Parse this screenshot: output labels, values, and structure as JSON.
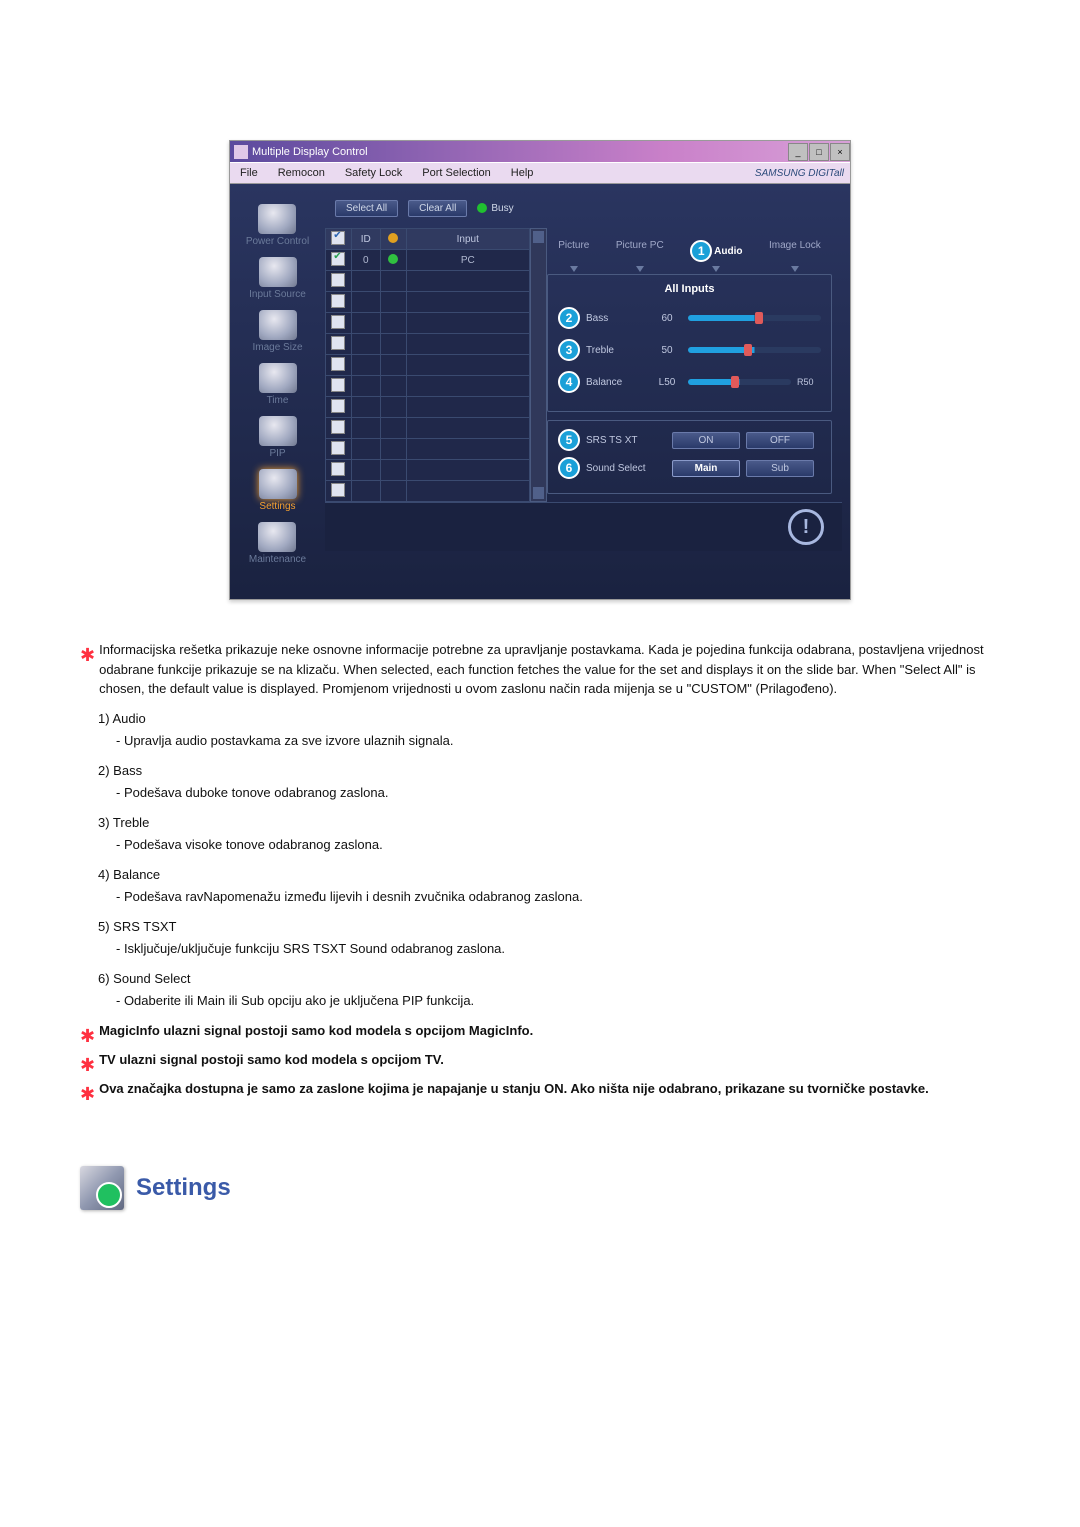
{
  "window": {
    "title": "Multiple Display Control",
    "brand": "SAMSUNG DIGITall"
  },
  "menubar": [
    "File",
    "Remocon",
    "Safety Lock",
    "Port Selection",
    "Help"
  ],
  "sidebar": {
    "items": [
      {
        "label": "Power Control"
      },
      {
        "label": "Input Source"
      },
      {
        "label": "Image Size"
      },
      {
        "label": "Time"
      },
      {
        "label": "PIP"
      },
      {
        "label": "Settings"
      },
      {
        "label": "Maintenance"
      }
    ]
  },
  "grid": {
    "select_all": "Select All",
    "clear_all": "Clear All",
    "busy": "Busy",
    "headers": {
      "chk": "✔",
      "id": "ID",
      "status": "",
      "input": "Input"
    },
    "row0": {
      "id": "0",
      "input": "PC"
    }
  },
  "tabs": {
    "picture": "Picture",
    "picture_pc": "Picture PC",
    "audio": "Audio",
    "image_lock": "Image Lock"
  },
  "audio_panel": {
    "all_inputs": "All Inputs",
    "bass": {
      "label": "Bass",
      "val": "60"
    },
    "treble": {
      "label": "Treble",
      "val": "50"
    },
    "balance": {
      "label": "Balance",
      "l": "L50",
      "r": "R50"
    },
    "srs": {
      "label": "SRS TS XT",
      "on": "ON",
      "off": "OFF"
    },
    "sound_select": {
      "label": "Sound Select",
      "main": "Main",
      "sub": "Sub"
    }
  },
  "callouts": {
    "c1": "1",
    "c2": "2",
    "c3": "3",
    "c4": "4",
    "c5": "5",
    "c6": "6"
  },
  "text": {
    "intro": "Informacijska rešetka prikazuje neke osnovne informacije potrebne za upravljanje postavkama. Kada je pojedina funkcija odabrana, postavljena vrijednost odabrane funkcije prikazuje se na klizaču. When selected, each function fetches the value for the set and displays it on the slide bar. When \"Select All\" is chosen, the default value is displayed. Promjenom vrijednosti u ovom zaslonu način rada mijenja se u \"CUSTOM\" (Prilagođeno).",
    "i1_h": "1)  Audio",
    "i1_b": "- Upravlja audio postavkama za sve izvore ulaznih signala.",
    "i2_h": "2)  Bass",
    "i2_b": "- Podešava duboke tonove odabranog zaslona.",
    "i3_h": "3)  Treble",
    "i3_b": "- Podešava visoke tonove odabranog zaslona.",
    "i4_h": "4)  Balance",
    "i4_b": "- Podešava ravNapomenažu između lijevih i desnih zvučnika odabranog zaslona.",
    "i5_h": "5)  SRS TSXT",
    "i5_b": "- Isključuje/uključuje funkciju SRS TSXT Sound odabranog zaslona.",
    "i6_h": "6)  Sound Select",
    "i6_b": "- Odaberite ili Main ili Sub opciju ako je uključena PIP funkcija.",
    "n1": "MagicInfo ulazni signal postoji samo kod modela s opcijom MagicInfo.",
    "n2": "TV ulazni signal postoji samo kod modela s opcijom TV.",
    "n3": "Ova značajka dostupna je samo za zaslone kojima je napajanje u stanju ON. Ako ništa nije odabrano, prikazane su tvorničke postavke.",
    "settings": "Settings"
  }
}
